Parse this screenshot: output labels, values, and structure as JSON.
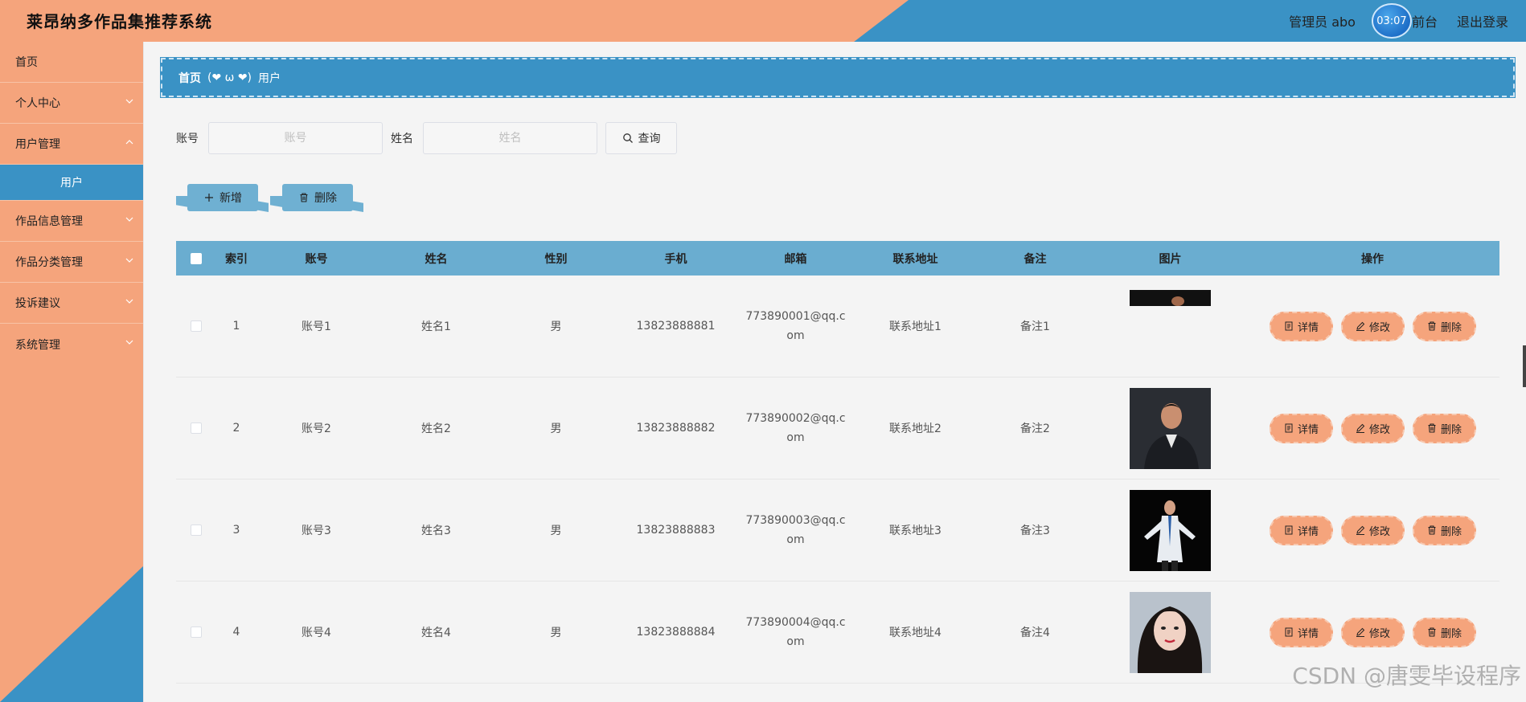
{
  "header": {
    "title": "莱昂纳多作品集推荐系统",
    "admin": "管理员 abo",
    "clock": "03:07",
    "front": "前台",
    "logout": "退出登录"
  },
  "sidebar": {
    "items": [
      {
        "label": "首页"
      },
      {
        "label": "个人中心"
      },
      {
        "label": "用户管理"
      },
      {
        "label": "用户"
      },
      {
        "label": "作品信息管理"
      },
      {
        "label": "作品分类管理"
      },
      {
        "label": "投诉建议"
      },
      {
        "label": "系统管理"
      }
    ]
  },
  "breadcrumb": {
    "home": "首页",
    "separator": "(❤ ω ❤)",
    "current": "用户"
  },
  "search": {
    "account_label": "账号",
    "account_placeholder": "账号",
    "name_label": "姓名",
    "name_placeholder": "姓名",
    "query_label": "查询"
  },
  "actions": {
    "add": "新增",
    "delete": "删除"
  },
  "table": {
    "headers": [
      "索引",
      "账号",
      "姓名",
      "性别",
      "手机",
      "邮箱",
      "联系地址",
      "备注",
      "图片",
      "操作"
    ],
    "rows": [
      {
        "idx": "1",
        "account": "账号1",
        "name": "姓名1",
        "sex": "男",
        "phone": "13823888881",
        "email": "773890001@qq.com",
        "addr": "联系地址1",
        "note": "备注1"
      },
      {
        "idx": "2",
        "account": "账号2",
        "name": "姓名2",
        "sex": "男",
        "phone": "13823888882",
        "email": "773890002@qq.com",
        "addr": "联系地址2",
        "note": "备注2"
      },
      {
        "idx": "3",
        "account": "账号3",
        "name": "姓名3",
        "sex": "男",
        "phone": "13823888883",
        "email": "773890003@qq.com",
        "addr": "联系地址3",
        "note": "备注3"
      },
      {
        "idx": "4",
        "account": "账号4",
        "name": "姓名4",
        "sex": "男",
        "phone": "13823888884",
        "email": "773890004@qq.com",
        "addr": "联系地址4",
        "note": "备注4"
      }
    ],
    "row_ops": {
      "detail": "详情",
      "edit": "修改",
      "delete": "删除"
    }
  },
  "watermark": "CSDN @唐雯毕设程序",
  "colors": {
    "accent_orange": "#f5a47c",
    "accent_blue": "#3a92c5",
    "table_header": "#6aadd0"
  }
}
